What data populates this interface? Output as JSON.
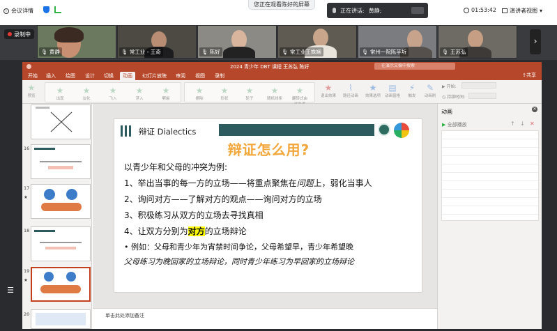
{
  "topbar": {
    "meeting_details": "会议详情",
    "sharing_notice": "您正在观看陈好的屏幕",
    "speaker_label": "正在讲话:",
    "speaker_name": "黄静;",
    "time": "01:53:42",
    "view_mode": "演讲者视图"
  },
  "video_strip": {
    "recording_label": "录制中",
    "participants": [
      {
        "name": "黄静"
      },
      {
        "name": "常工业 - 王奇"
      },
      {
        "name": "陈好"
      },
      {
        "name": "常工业王姝娴"
      },
      {
        "name": "常州一院陈芋圻"
      },
      {
        "name": "王苏弘"
      }
    ]
  },
  "ppt": {
    "title": "2024 青少年 DBT 课程 王苏弘 陈好",
    "search_placeholder": "在演示文稿中搜索",
    "share_label": "共享",
    "tabs": [
      "开始",
      "插入",
      "绘图",
      "设计",
      "切换",
      "动画",
      "幻灯片放映",
      "审阅",
      "视图",
      "录制"
    ],
    "active_tab": "动画",
    "ribbon": {
      "preview": "预览",
      "effects": [
        "出现",
        "淡化",
        "飞入",
        "浮入",
        "劈裂"
      ],
      "effects2": [
        "擦除",
        "形状",
        "轮子",
        "随机线条",
        "翻转式由远及近"
      ],
      "options": [
        "效果选项",
        "添加动画",
        "动画窗格",
        "触发",
        "动画刷"
      ],
      "start_label": "开始:",
      "duration_label": "持续时间:",
      "advanced": [
        "退出效果",
        "路径动画",
        "效果选项",
        "动画窗格",
        "触发",
        "动画刷"
      ]
    },
    "thumbnails": [
      {
        "num": "16"
      },
      {
        "num": "17"
      },
      {
        "num": "18"
      },
      {
        "num": "19"
      },
      {
        "num": "20"
      }
    ],
    "slide": {
      "title_en": "辩证 Dialectics",
      "heading": "辩证怎么用?",
      "lines": [
        "以青少年和父母的冲突为例:",
        "1、举出当事的每一方的立场——将重点聚焦在",
        "问题",
        "上，弱化当事人",
        "2、询问对方——了解对方的观点——询问对方的立场",
        "3、积极练习从双方的立场去寻找真相",
        "4、让双方分别为",
        "对方",
        "的立场辩论",
        "• 例如：父母和青少年为宵禁时间争论，父母希望早，青少年希望晚",
        "父母练习为晚回家的立场辩论，同时青少年练习为早回家的立场辩论"
      ]
    },
    "notes_placeholder": "单击此处添加备注",
    "anim_pane": {
      "title": "动画",
      "play_all": "全部播放"
    }
  },
  "colors": {
    "ppt_accent": "#b7472a",
    "slide_teal": "#2d5a5f",
    "heading_orange": "#f3a73b",
    "highlight": "#ffff00"
  }
}
